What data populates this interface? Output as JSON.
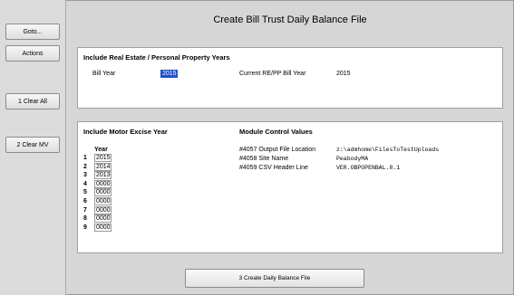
{
  "window_title": "Create Bill Trust Daily Balance File",
  "sidebar": {
    "goto_label": "Goto...",
    "actions_label": "Actions",
    "clear_all_label": "1 Clear All",
    "clear_mv_label": "2 Clear MV"
  },
  "re_panel": {
    "heading": "Include Real Estate / Personal Property Years",
    "bill_year_label": "Bill Year",
    "bill_year_value": "2015",
    "current_label": "Current RE/PP Bill Year",
    "current_value": "2015"
  },
  "mv_panel": {
    "heading": "Include Motor Excise Year",
    "year_header": "Year",
    "rows": [
      {
        "num": "1",
        "year": "2015"
      },
      {
        "num": "2",
        "year": "2014"
      },
      {
        "num": "3",
        "year": "2013"
      },
      {
        "num": "4",
        "year": "0000"
      },
      {
        "num": "5",
        "year": "0000"
      },
      {
        "num": "6",
        "year": "0000"
      },
      {
        "num": "7",
        "year": "0000"
      },
      {
        "num": "8",
        "year": "0000"
      },
      {
        "num": "9",
        "year": "0000"
      }
    ]
  },
  "control_values": {
    "heading": "Module Control Values",
    "items": [
      {
        "label": "#4057 Output File Location",
        "value": "z:\\admhome\\FilesToTestUploads"
      },
      {
        "label": "#4058 Site Name",
        "value": "PeabodyMA"
      },
      {
        "label": "#4059 CSV Header Line",
        "value": "VER.OBPOPENBAL.8.1"
      }
    ]
  },
  "create_button_label": "3 Create Daily Balance File"
}
